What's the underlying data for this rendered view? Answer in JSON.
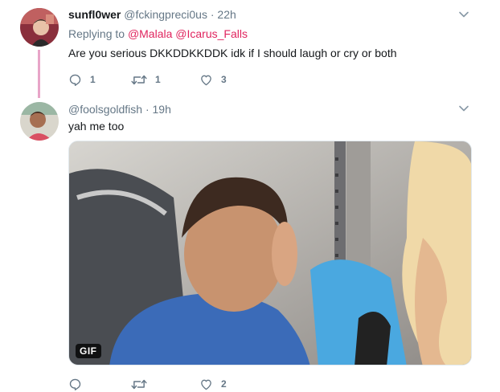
{
  "tweets": [
    {
      "name": "sunfl0wer",
      "handle": "@fckingpreci0us",
      "separator": "·",
      "time": "22h",
      "replying_prefix": "Replying to",
      "mentions": [
        "@Malala",
        "@Icarus_Falls"
      ],
      "text": "Are you serious DKKDDKKDDK idk if I should laugh or cry or both",
      "counts": {
        "replies": "1",
        "retweets": "1",
        "likes": "3"
      }
    },
    {
      "handle": "@foolsgoldfish",
      "separator": "·",
      "time": "19h",
      "text": "yah me too",
      "media_badge": "GIF",
      "counts": {
        "replies": "",
        "retweets": "",
        "likes": "2"
      }
    }
  ],
  "colors": {
    "text": "#14171a",
    "muted": "#657786",
    "mention": "#e0245e",
    "thread_line": "#e8a5c8"
  },
  "icons": {
    "reply": "reply-icon",
    "retweet": "retweet-icon",
    "like": "heart-icon",
    "menu": "chevron-down-icon"
  }
}
